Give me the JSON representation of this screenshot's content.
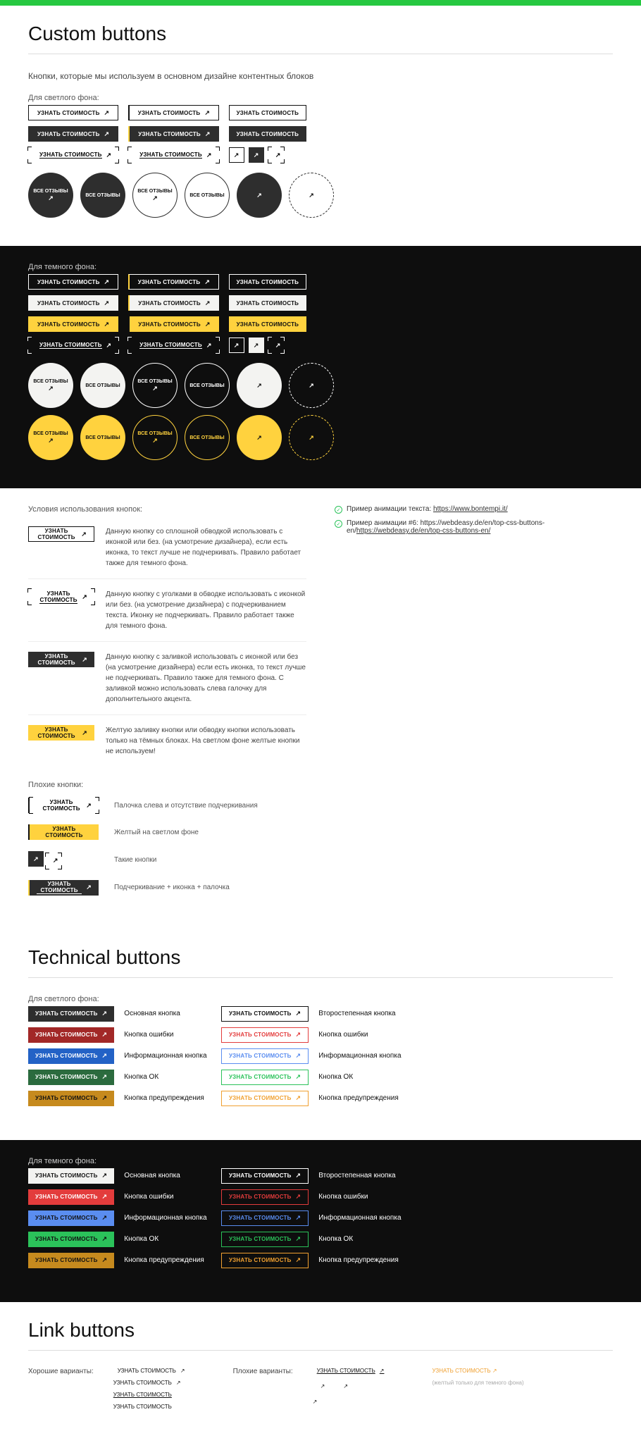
{
  "top_bar_color": "#26c841",
  "section1": {
    "title": "Custom buttons",
    "intro": "Кнопки, которые мы используем в основном дизайне контентных блоков",
    "light_label": "Для светлого фона:",
    "dark_label": "Для темного фона:",
    "btn_label": "УЗНАТЬ СТОИМОСТЬ",
    "circle_label": "ВСЕ ОТЗЫВЫ",
    "conditions_title": "Условия использования кнопок:",
    "cond1": "Данную кнопку со сплошной обводкой использовать с иконкой или без. (на усмотрение дизайнера), если есть иконка, то текст лучше не подчеркивать. Правило работает также для темного фона.",
    "cond2": "Данную кнопку с уголками в обводке использовать с иконкой или без. (на усмотрение дизайнера) с подчеркиванием текста. Иконку не подчеркивать. Правило работает также для темного фона.",
    "cond3": "Данную кнопку с заливкой использовать с иконкой или без (на усмотрение дизайнера) если есть иконка, то текст лучше не подчеркивать. Правило также для темного фона. С заливкой можно использовать слева галочку для дополнительного акцента.",
    "cond4": "Желтую заливку кнопки или обводку кнопки использовать только на тёмных блоках. На светлом фоне желтые кнопки не используем!",
    "bad_title": "Плохие кнопки:",
    "bad1": "Палочка слева и отсутствие подчеркивания",
    "bad2": "Желтый на светлом фоне",
    "bad3": "Такие кнопки",
    "bad4": "Подчеркивание + иконка + палочка",
    "anim1_pre": "Пример анимации текста:",
    "anim1_link": "https://www.bontempi.it/",
    "anim2_pre": "Пример анимации #6: https://webdeasy.de/en/top-css-buttons-en/",
    "anim2_link": "https://webdeasy.de/en/top-css-buttons-en/"
  },
  "section2": {
    "title": "Technical buttons",
    "light_label": "Для светлого фона:",
    "dark_label": "Для темного фона:",
    "btn_label": "УЗНАТЬ СТОИМОСТЬ",
    "desc_primary": "Основная кнопка",
    "desc_secondary": "Второстепенная кнопка",
    "desc_error": "Кнопка ошибки",
    "desc_info": "Информационная кнопка",
    "desc_ok": "Кнопка ОК",
    "desc_warn": "Кнопка предупреждения"
  },
  "section3": {
    "title": "Link buttons",
    "good_label": "Хорошие варианты:",
    "bad_label": "Плохие варианты:",
    "btn_label": "УЗНАТЬ СТОИМОСТЬ",
    "yellow_note": "УЗНАТЬ СТОИМОСТЬ ↗",
    "yellow_sub": "(желтый только для темного фона)"
  }
}
